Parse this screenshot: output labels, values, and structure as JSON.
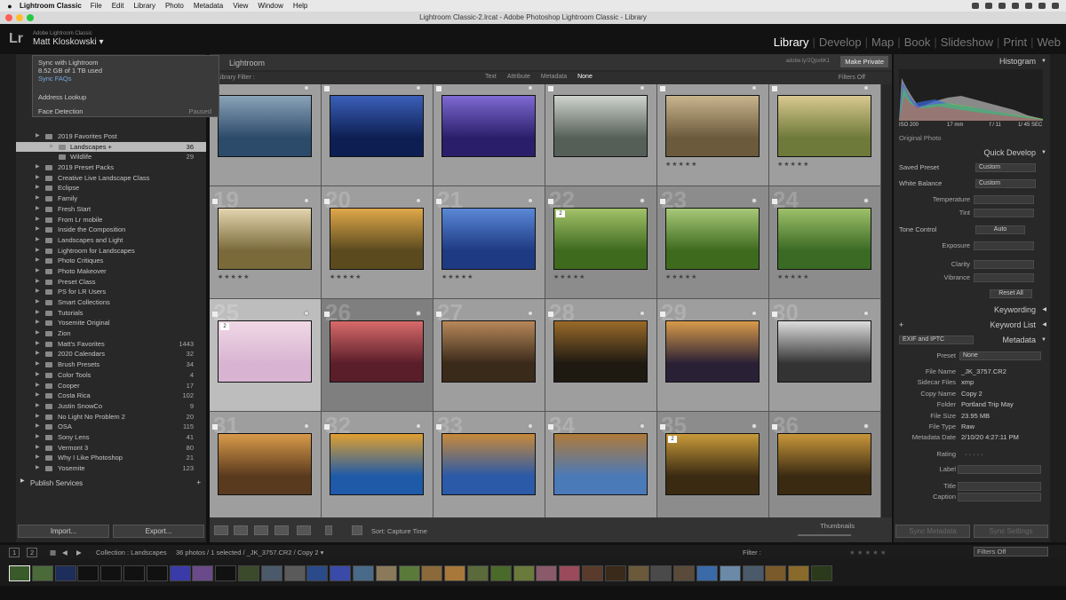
{
  "menubar": {
    "apple": "",
    "app": "Lightroom Classic",
    "items": [
      "File",
      "Edit",
      "Library",
      "Photo",
      "Metadata",
      "View",
      "Window",
      "Help"
    ]
  },
  "titlebar": {
    "title": "Lightroom Classic-2.lrcat - Adobe Photoshop Lightroom Classic - Library"
  },
  "identity": {
    "logo": "Lr",
    "subtitle": "Adobe Lightroom Classic",
    "user": "Matt Kloskowski ▾"
  },
  "modules": [
    "Library",
    "Develop",
    "Map",
    "Book",
    "Slideshow",
    "Print",
    "Web"
  ],
  "active_module": "Library",
  "sync_popup": {
    "title": "Sync with Lightroom",
    "usage": "8.52 GB of 1 TB used",
    "faq": "Sync FAQs",
    "address_lookup": "Address Lookup",
    "face_detection": "Face Detection",
    "face_status": "Paused"
  },
  "collections": [
    {
      "label": "2019 Favorites Post",
      "count": "",
      "level": 0
    },
    {
      "label": "Landscapes +",
      "count": "36",
      "level": 1,
      "selected": true
    },
    {
      "label": "Wildlife",
      "count": "29",
      "level": 1
    },
    {
      "label": "2019 Preset Packs",
      "count": "",
      "level": 0
    },
    {
      "label": "Creative Live Landscape Class",
      "count": "",
      "level": 0
    },
    {
      "label": "Eclipse",
      "count": "",
      "level": 0
    },
    {
      "label": "Family",
      "count": "",
      "level": 0
    },
    {
      "label": "Fresh Start",
      "count": "",
      "level": 0
    },
    {
      "label": "From Lr mobile",
      "count": "",
      "level": 0
    },
    {
      "label": "Inside the Composition",
      "count": "",
      "level": 0
    },
    {
      "label": "Landscapes and Light",
      "count": "",
      "level": 0
    },
    {
      "label": "Lightroom for Landscapes",
      "count": "",
      "level": 0
    },
    {
      "label": "Photo Critiques",
      "count": "",
      "level": 0
    },
    {
      "label": "Photo Makeover",
      "count": "",
      "level": 0
    },
    {
      "label": "Preset Class",
      "count": "",
      "level": 0
    },
    {
      "label": "PS for LR Users",
      "count": "",
      "level": 0
    },
    {
      "label": "Smart Collections",
      "count": "",
      "level": 0
    },
    {
      "label": "Tutorials",
      "count": "",
      "level": 0
    },
    {
      "label": "Yosemite Original",
      "count": "",
      "level": 0
    },
    {
      "label": "Zion",
      "count": "",
      "level": 0
    },
    {
      "label": "Matt's Favorites",
      "count": "1443",
      "level": 0
    },
    {
      "label": "2020 Calendars",
      "count": "32",
      "level": 0
    },
    {
      "label": "Brush Presets",
      "count": "34",
      "level": 0
    },
    {
      "label": "Color Tools",
      "count": "4",
      "level": 0
    },
    {
      "label": "Cooper",
      "count": "17",
      "level": 0
    },
    {
      "label": "Costa Rica",
      "count": "102",
      "level": 0
    },
    {
      "label": "Justin SnowCo",
      "count": "9",
      "level": 0
    },
    {
      "label": "No Light No Problem 2",
      "count": "20",
      "level": 0
    },
    {
      "label": "OSA",
      "count": "115",
      "level": 0
    },
    {
      "label": "Sony Lens",
      "count": "41",
      "level": 0
    },
    {
      "label": "Vermont 3",
      "count": "80",
      "level": 0
    },
    {
      "label": "Why I Like Photoshop",
      "count": "21",
      "level": 0
    },
    {
      "label": "Yosemite",
      "count": "123",
      "level": 0
    }
  ],
  "publish": {
    "label": "Publish Services",
    "plus": "+"
  },
  "buttons": {
    "import": "Import...",
    "export": "Export..."
  },
  "center": {
    "title": "Lightroom",
    "url": "adobe.ly/2Qpx6K1",
    "make_private": "Make Private",
    "filter_label": "Library Filter :",
    "filter_tabs": [
      "Text",
      "Attribute",
      "Metadata",
      "None"
    ],
    "filter_active": "None",
    "filters_off": "Filters Off"
  },
  "grid": [
    {
      "num": "",
      "stars": "",
      "colors": [
        "#2c4a6a",
        "#8aa3b8"
      ]
    },
    {
      "num": "",
      "stars": "",
      "colors": [
        "#0d1f52",
        "#3b5fb8"
      ]
    },
    {
      "num": "",
      "stars": "",
      "colors": [
        "#2a1e6a",
        "#7e6ad2"
      ]
    },
    {
      "num": "",
      "stars": "",
      "colors": [
        "#555f58",
        "#cfd3cd"
      ]
    },
    {
      "num": "",
      "stars": "★★★★★",
      "colors": [
        "#6b5a3c",
        "#c9b48d"
      ]
    },
    {
      "num": "",
      "stars": "★★★★★",
      "colors": [
        "#6e7a3a",
        "#d8c890"
      ]
    },
    {
      "num": "19",
      "stars": "★★★★★",
      "colors": [
        "#7a6a3a",
        "#e4d5b0"
      ]
    },
    {
      "num": "20",
      "stars": "★★★★★",
      "colors": [
        "#5a4a1e",
        "#e0a84a"
      ]
    },
    {
      "num": "21",
      "stars": "★★★★★",
      "colors": [
        "#1e3a82",
        "#5a88d6"
      ]
    },
    {
      "num": "22",
      "stars": "★★★★★",
      "colors": [
        "#3e6a1e",
        "#a3c26a"
      ],
      "badge": "2"
    },
    {
      "num": "23",
      "stars": "★★★★★",
      "colors": [
        "#3e6a1e",
        "#a8c878"
      ]
    },
    {
      "num": "24",
      "stars": "★★★★★",
      "colors": [
        "#3a6a24",
        "#9ec06a"
      ]
    },
    {
      "num": "25",
      "stars": "",
      "colors": [
        "#d8b4d2",
        "#f0d8e6"
      ],
      "badge": "2"
    },
    {
      "num": "26",
      "stars": "",
      "colors": [
        "#5a1e2a",
        "#d86a6a"
      ]
    },
    {
      "num": "27",
      "stars": "",
      "colors": [
        "#3a2a1a",
        "#b8885a"
      ]
    },
    {
      "num": "28",
      "stars": "",
      "colors": [
        "#1e1a12",
        "#9a6a2a"
      ]
    },
    {
      "num": "29",
      "stars": "",
      "colors": [
        "#2a2036",
        "#d89a4a"
      ]
    },
    {
      "num": "30",
      "stars": "",
      "colors": [
        "#333333",
        "#dddddd"
      ]
    },
    {
      "num": "31",
      "stars": "",
      "colors": [
        "#5a3a1e",
        "#d89a4a"
      ]
    },
    {
      "num": "32",
      "stars": "",
      "colors": [
        "#1e5aa8",
        "#e0a030"
      ]
    },
    {
      "num": "33",
      "stars": "",
      "colors": [
        "#2a5aa8",
        "#c88a3a"
      ]
    },
    {
      "num": "34",
      "stars": "",
      "colors": [
        "#4a7ab8",
        "#b07a3a"
      ]
    },
    {
      "num": "35",
      "stars": "",
      "colors": [
        "#3a2a12",
        "#c89a3a"
      ],
      "badge": "2"
    },
    {
      "num": "36",
      "stars": "",
      "colors": [
        "#3a2a12",
        "#c8963a"
      ]
    }
  ],
  "toolbar": {
    "sort_label": "Sort:",
    "sort_value": "Capture Time",
    "thumbnails": "Thumbnails"
  },
  "right": {
    "histogram": "Histogram",
    "hist_info": [
      "ISO 200",
      "17 mm",
      "f / 11",
      "1/ 45 SEC"
    ],
    "original_photo": "Original Photo",
    "quick_develop": "Quick Develop",
    "saved_preset": "Saved Preset",
    "saved_preset_val": "Custom",
    "white_balance": "White Balance",
    "white_balance_val": "Custom",
    "temperature": "Temperature",
    "tint": "Tint",
    "tone_control": "Tone Control",
    "auto": "Auto",
    "exposure": "Exposure",
    "clarity": "Clarity",
    "vibrance": "Vibrance",
    "reset_all": "Reset All",
    "keywording": "Keywording",
    "keyword_list": "Keyword List",
    "metadata": "Metadata",
    "exif": "EXIF and IPTC",
    "preset": "Preset",
    "preset_val": "None",
    "fields": [
      {
        "label": "File Name",
        "value": "_JK_3757.CR2"
      },
      {
        "label": "Sidecar Files",
        "value": "xmp"
      },
      {
        "label": "Copy Name",
        "value": "Copy 2"
      },
      {
        "label": "Folder",
        "value": "Portland Trip May"
      },
      {
        "label": "File Size",
        "value": "23.95 MB"
      },
      {
        "label": "File Type",
        "value": "Raw"
      },
      {
        "label": "Metadata Date",
        "value": "2/10/20 4:27:11 PM"
      }
    ],
    "rating": "Rating",
    "rating_val": "· · · · ·",
    "label": "Label",
    "title": "Title",
    "caption": "Caption",
    "sync_metadata": "Sync Metadata",
    "sync_settings": "Sync Settings"
  },
  "filmbar": {
    "pages": [
      "1",
      "2"
    ],
    "collection": "Collection : Landscapes",
    "count": "36 photos / 1 selected / _JK_3757.CR2 / Copy 2 ▾",
    "filter": "Filter :",
    "filters_off": "Filters Off"
  },
  "filmstrip": [
    "#3a5a2a",
    "#4a6a3a",
    "#1e2e5a",
    "#111111",
    "#111111",
    "#111111",
    "#111111",
    "#3a3aa8",
    "#6a4a8a",
    "#111111",
    "#3a4a2a",
    "#4a5a6a",
    "#5a5a5a",
    "#2a4a8a",
    "#3a4aa8",
    "#4a6a8a",
    "#8a7a5a",
    "#5a7a3a",
    "#8a6a3a",
    "#a8783a",
    "#5a6a3a",
    "#4a6a2a",
    "#6a7a3a",
    "#8a5a6a",
    "#9a4a5a",
    "#5a3a2a",
    "#3a2a1a",
    "#6a5a3a",
    "#4a4a4a",
    "#5a4a3a",
    "#3a6aa8",
    "#6a8aa8",
    "#4a5a6a",
    "#7a5a2a",
    "#8a6a2a",
    "#2a3a1a"
  ]
}
